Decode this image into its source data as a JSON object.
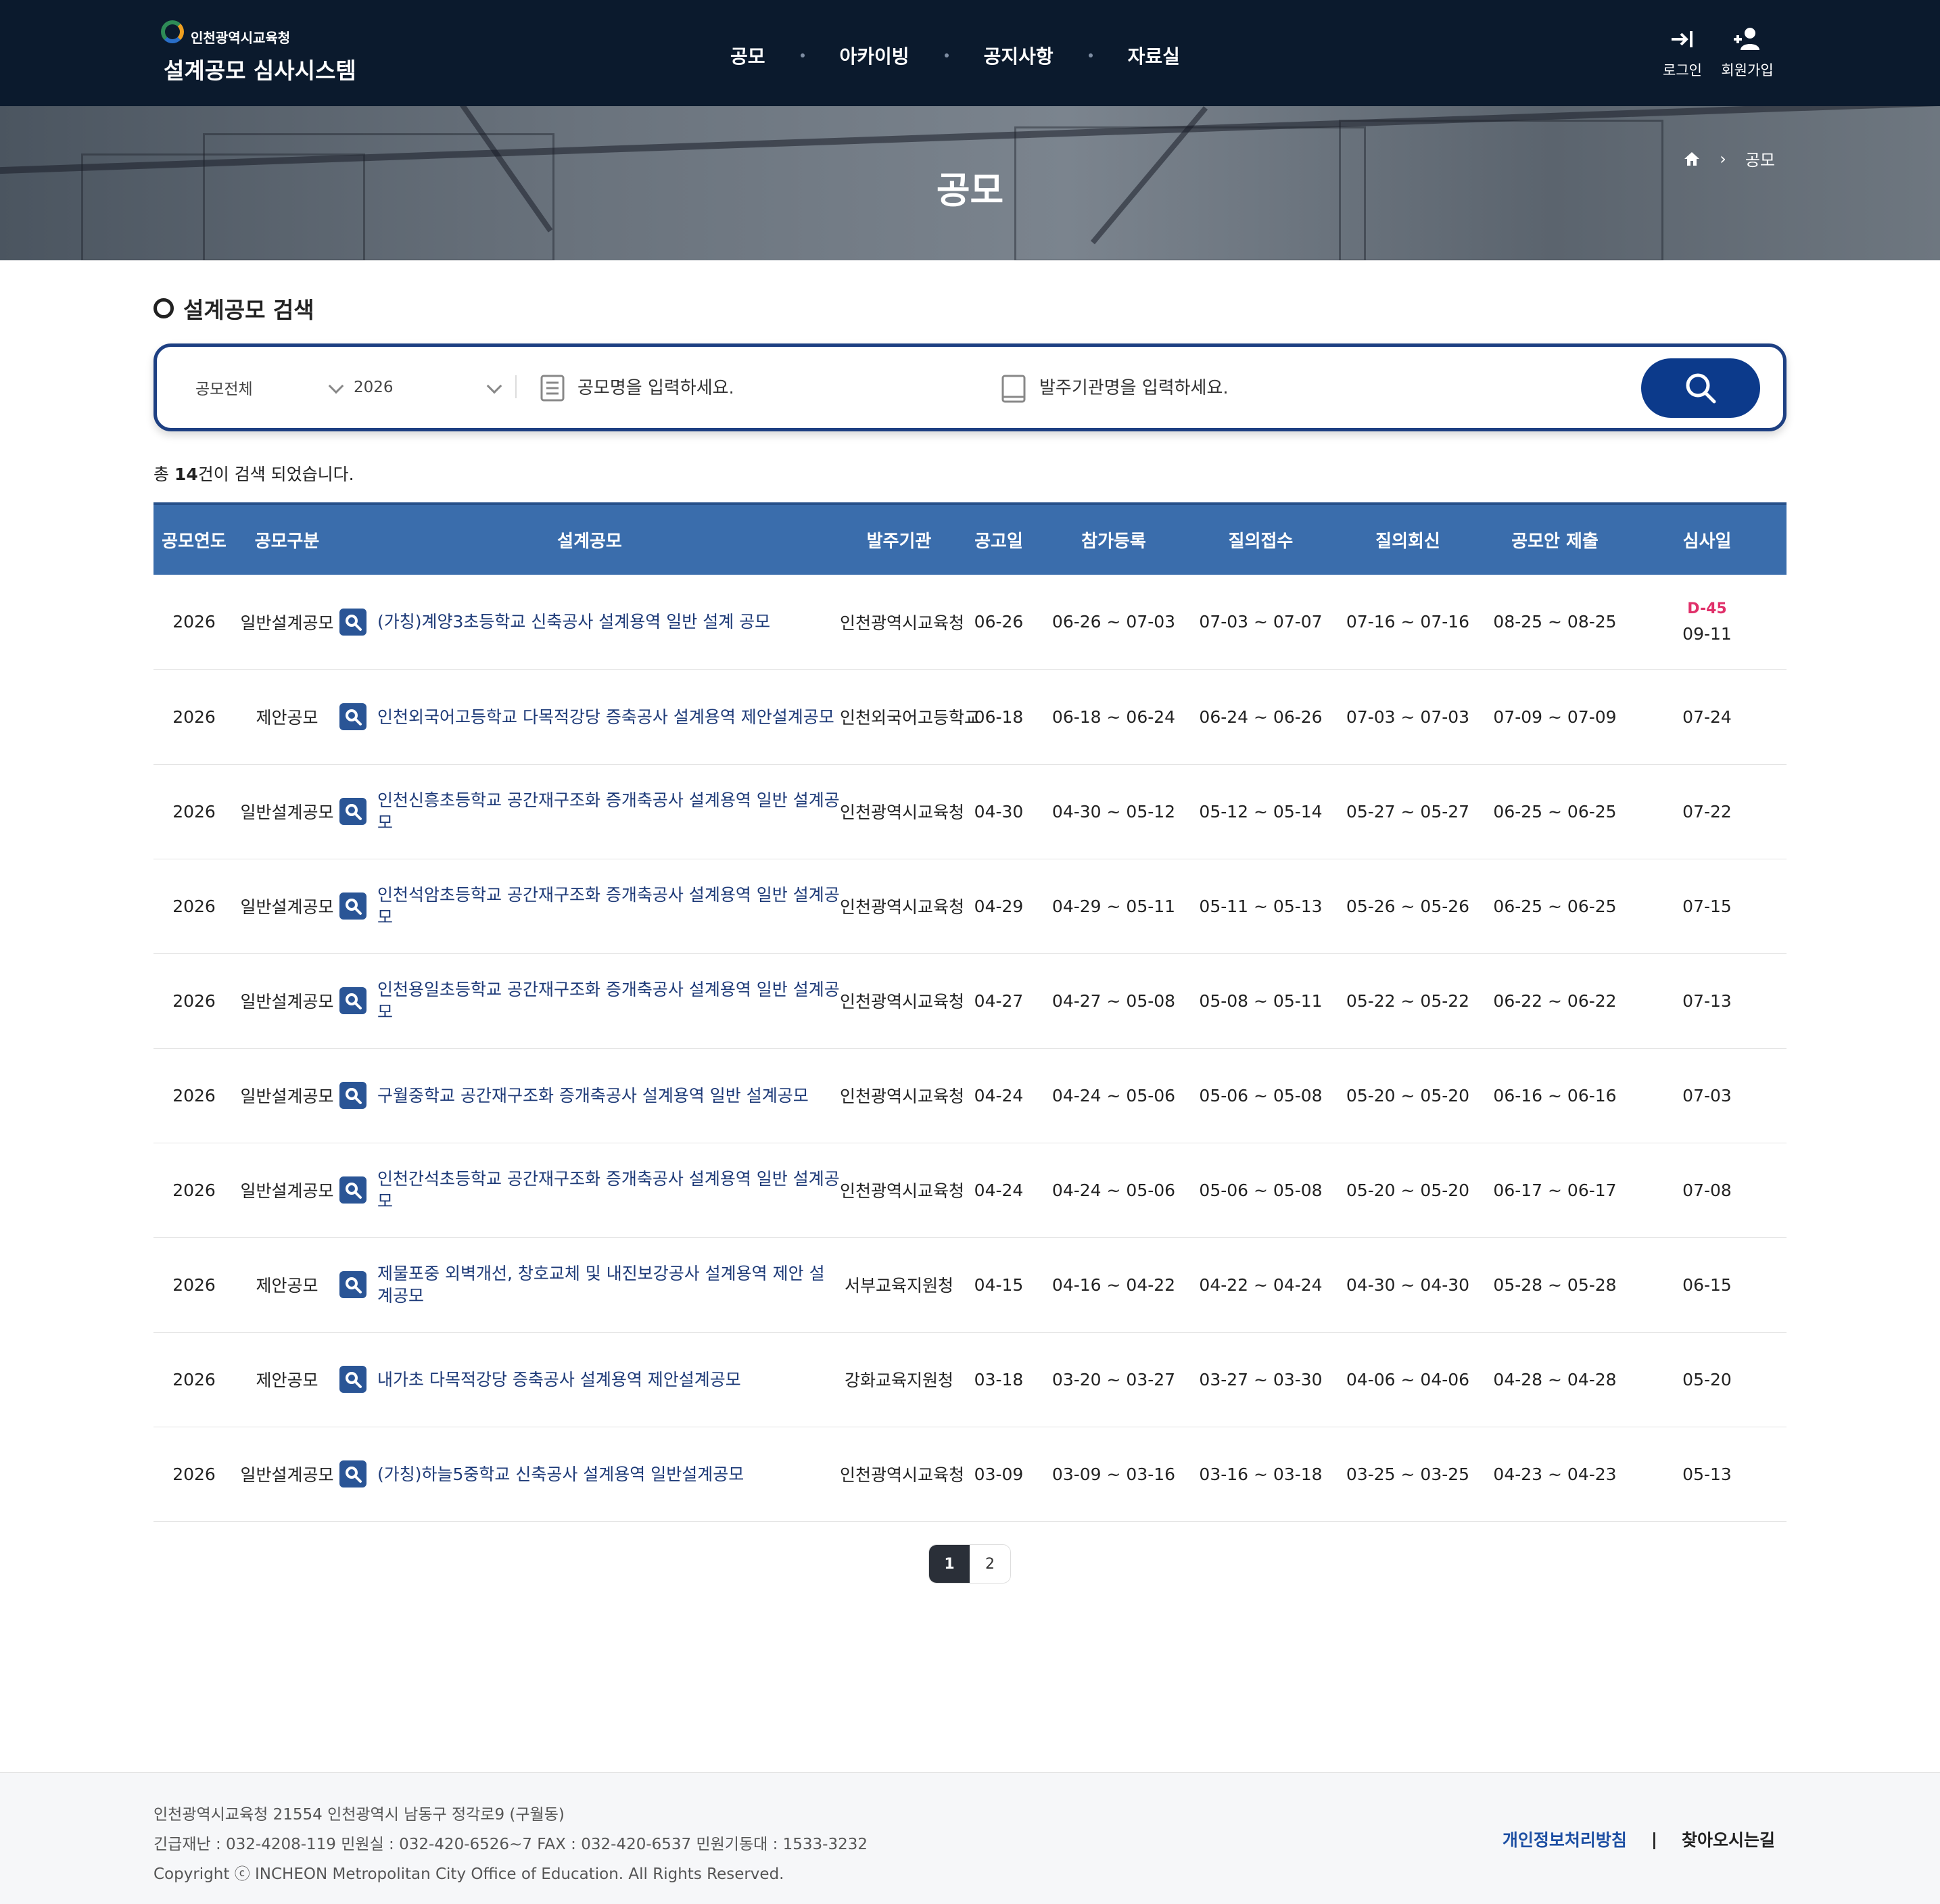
{
  "header": {
    "logo_sub": "인천광역시교육청",
    "logo_main": "설계공모 심사시스템",
    "nav": [
      "공모",
      "아카이빙",
      "공지사항",
      "자료실"
    ],
    "login_label": "로그인",
    "signup_label": "회원가입"
  },
  "banner": {
    "title": "공모",
    "breadcrumb_current": "공모"
  },
  "search": {
    "section_title": "설계공모 검색",
    "category_value": "공모전체",
    "year_value": "2026",
    "name_placeholder": "공모명을 입력하세요.",
    "agency_placeholder": "발주기관명을 입력하세요."
  },
  "result": {
    "prefix": "총 ",
    "count": "14",
    "suffix": "건이 검색 되었습니다."
  },
  "table": {
    "headers": [
      "공모연도",
      "공모구분",
      "설계공모",
      "발주기관",
      "공고일",
      "참가등록",
      "질의접수",
      "질의회신",
      "공모안 제출",
      "심사일"
    ],
    "rows": [
      {
        "year": "2026",
        "type": "일반설계공모",
        "title": "(가칭)계양3초등학교 신축공사 설계용역 일반 설계 공모",
        "agency": "인천광역시교육청",
        "notice": "06-26",
        "register": "06-26 ~ 07-03",
        "q_recv": "07-03 ~ 07-07",
        "q_reply": "07-16 ~ 07-16",
        "submit": "08-25 ~ 08-25",
        "review": "09-11",
        "dday": "D-45"
      },
      {
        "year": "2026",
        "type": "제안공모",
        "title": "인천외국어고등학교 다목적강당 증축공사 설계용역 제안설계공모",
        "agency": "인천외국어고등학교",
        "notice": "06-18",
        "register": "06-18 ~ 06-24",
        "q_recv": "06-24 ~ 06-26",
        "q_reply": "07-03 ~ 07-03",
        "submit": "07-09 ~ 07-09",
        "review": "07-24",
        "dday": ""
      },
      {
        "year": "2026",
        "type": "일반설계공모",
        "title": "인천신흥초등학교 공간재구조화 증개축공사 설계용역 일반 설계공모",
        "agency": "인천광역시교육청",
        "notice": "04-30",
        "register": "04-30 ~ 05-12",
        "q_recv": "05-12 ~ 05-14",
        "q_reply": "05-27 ~ 05-27",
        "submit": "06-25 ~ 06-25",
        "review": "07-22",
        "dday": ""
      },
      {
        "year": "2026",
        "type": "일반설계공모",
        "title": "인천석암초등학교 공간재구조화 증개축공사 설계용역 일반 설계공모",
        "agency": "인천광역시교육청",
        "notice": "04-29",
        "register": "04-29 ~ 05-11",
        "q_recv": "05-11 ~ 05-13",
        "q_reply": "05-26 ~ 05-26",
        "submit": "06-25 ~ 06-25",
        "review": "07-15",
        "dday": ""
      },
      {
        "year": "2026",
        "type": "일반설계공모",
        "title": "인천용일초등학교 공간재구조화 증개축공사 설계용역 일반 설계공모",
        "agency": "인천광역시교육청",
        "notice": "04-27",
        "register": "04-27 ~ 05-08",
        "q_recv": "05-08 ~ 05-11",
        "q_reply": "05-22 ~ 05-22",
        "submit": "06-22 ~ 06-22",
        "review": "07-13",
        "dday": ""
      },
      {
        "year": "2026",
        "type": "일반설계공모",
        "title": "구월중학교 공간재구조화 증개축공사 설계용역 일반 설계공모",
        "agency": "인천광역시교육청",
        "notice": "04-24",
        "register": "04-24 ~ 05-06",
        "q_recv": "05-06 ~ 05-08",
        "q_reply": "05-20 ~ 05-20",
        "submit": "06-16 ~ 06-16",
        "review": "07-03",
        "dday": ""
      },
      {
        "year": "2026",
        "type": "일반설계공모",
        "title": "인천간석초등학교 공간재구조화 증개축공사 설계용역 일반 설계공모",
        "agency": "인천광역시교육청",
        "notice": "04-24",
        "register": "04-24 ~ 05-06",
        "q_recv": "05-06 ~ 05-08",
        "q_reply": "05-20 ~ 05-20",
        "submit": "06-17 ~ 06-17",
        "review": "07-08",
        "dday": ""
      },
      {
        "year": "2026",
        "type": "제안공모",
        "title": "제물포중 외벽개선, 창호교체 및 내진보강공사 설계용역 제안 설계공모",
        "agency": "서부교육지원청",
        "notice": "04-15",
        "register": "04-16 ~ 04-22",
        "q_recv": "04-22 ~ 04-24",
        "q_reply": "04-30 ~ 04-30",
        "submit": "05-28 ~ 05-28",
        "review": "06-15",
        "dday": ""
      },
      {
        "year": "2026",
        "type": "제안공모",
        "title": "내가초 다목적강당 증축공사 설계용역 제안설계공모",
        "agency": "강화교육지원청",
        "notice": "03-18",
        "register": "03-20 ~ 03-27",
        "q_recv": "03-27 ~ 03-30",
        "q_reply": "04-06 ~ 04-06",
        "submit": "04-28 ~ 04-28",
        "review": "05-20",
        "dday": ""
      },
      {
        "year": "2026",
        "type": "일반설계공모",
        "title": "(가칭)하늘5중학교 신축공사 설계용역 일반설계공모",
        "agency": "인천광역시교육청",
        "notice": "03-09",
        "register": "03-09 ~ 03-16",
        "q_recv": "03-16 ~ 03-18",
        "q_reply": "03-25 ~ 03-25",
        "submit": "04-23 ~ 04-23",
        "review": "05-13",
        "dday": ""
      }
    ]
  },
  "pagination": {
    "pages": [
      "1",
      "2"
    ],
    "current": "1"
  },
  "footer": {
    "address": "인천광역시교육청 21554 인천광역시 남동구 정각로9 (구월동)",
    "contact": "긴급재난 : 032-4208-119 민원실 : 032-420-6526~7 FAX : 032-420-6537 민원기동대 : 1533-3232",
    "copyright": "Copyright ⓒ INCHEON Metropolitan City Office of Education. All Rights Reserved.",
    "privacy_link": "개인정보처리방침",
    "separator": "|",
    "directions_link": "찾아오시는길"
  },
  "colors": {
    "header_bg": "#0b1a2d",
    "table_header": "#3a6dac",
    "search_border": "#1d3f82",
    "search_button": "#0c3a8b",
    "link": "#1d3a78",
    "dday": "#e0306a"
  }
}
